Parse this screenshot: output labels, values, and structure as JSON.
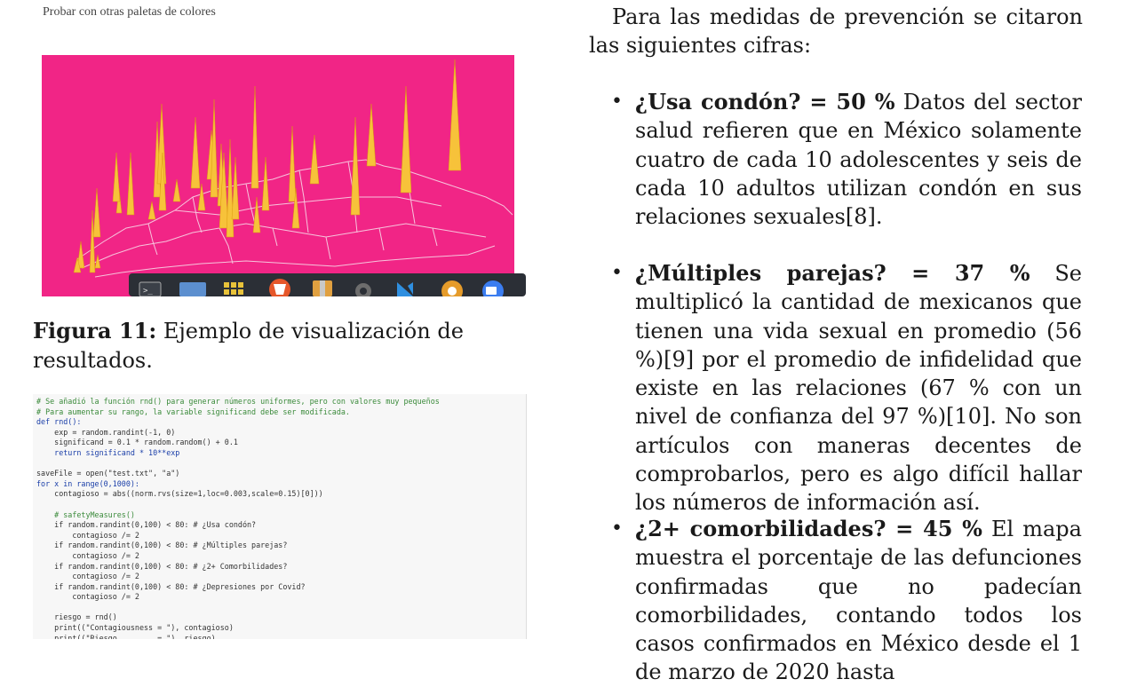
{
  "left": {
    "top_note": "Probar con otras paletas de colores",
    "figure": {
      "background_color": "#f12586",
      "spike_color": "#f7c23a",
      "taskbar_icons": [
        "terminal-icon",
        "folder-icon",
        "apps-grid-icon",
        "brave-browser-icon",
        "archive-icon",
        "settings-icon",
        "vscode-icon",
        "blender-icon",
        "zoom-icon"
      ]
    },
    "caption_label": "Figura 11:",
    "caption_text": " Ejemplo de visualización de resulta­dos.",
    "code_lines": [
      "# Se añadió la función rnd() para generar números uniformes, pero con valores muy pequeños",
      "# Para aumentar su rango, la variable significand debe ser modificada.",
      "def rnd():",
      "    exp = random.randint(-1, 0)",
      "    significand = 0.1 * random.random() + 0.1",
      "    return significand * 10**exp",
      "",
      "saveFile = open(\"test.txt\", \"a\")",
      "for x in range(0,1000):",
      "    contagioso = abs((norm.rvs(size=1,loc=0.003,scale=0.15)[0]))",
      "",
      "    # safetyMeasures()",
      "    if random.randint(0,100) < 80: # ¿Usa condón?",
      "        contagioso /= 2",
      "    if random.randint(0,100) < 80: # ¿Múltiples parejas?",
      "        contagioso /= 2",
      "    if random.randint(0,100) < 80: # ¿2+ Comorbilidades?",
      "        contagioso /= 2",
      "    if random.randint(0,100) < 80: # ¿Depresiones por Covid?",
      "        contagioso /= 2",
      "",
      "    riesgo = rnd()",
      "    print((\"Contagiousness = \"), contagioso)",
      "    print((\"Riesgo         = \"), riesgo)"
    ]
  },
  "right": {
    "intro": "Para las medidas de prevención se citaron las siguientes cifras:",
    "bullets": [
      {
        "bold": "¿Usa condón? = 50 %",
        "text": " Datos del sector salud refieren que en México solamente cuatro de cada 10 adolescentes y seis de cada 10 adultos utilizan condón en sus relaciones sexuales[8]."
      },
      {
        "bold": "¿Múltiples parejas? = 37 %",
        "text": " Se multiplicó la cantidad de mexicanos que tienen una vida sexual en promedio (56 %)[9] por el promedio de infidelidad que existe en las relaciones (67 % con un nivel de confianza del 97 %)[10]. No son artículos con maneras decentes de comprobarlos, pero es algo difícil hallar los números de información así."
      },
      {
        "bold": "¿2+ comorbilidades? = 45 %",
        "text": " El mapa muestra el porcentaje de las defunciones confirmadas que no padecían comorbilida­des, contando todos los casos confirmados en México desde el 1 de marzo de 2020 hasta"
      }
    ]
  }
}
